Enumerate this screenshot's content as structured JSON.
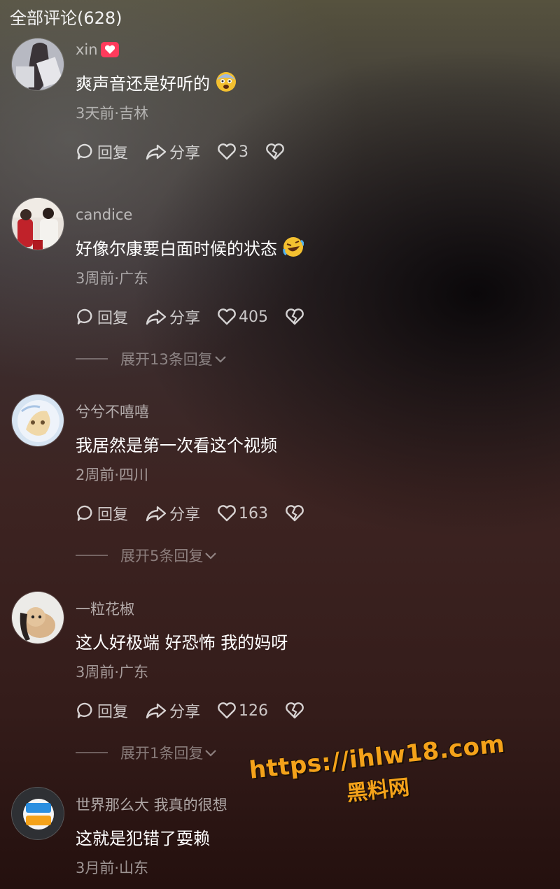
{
  "header": {
    "title": "全部评论(628)"
  },
  "actions": {
    "reply": "回复",
    "share": "分享"
  },
  "comments": [
    {
      "user": "xin",
      "text": "爽声音还是好听的",
      "meta": "3天前·吉林",
      "likes": "3",
      "emoji": "fearful-face",
      "badge": "heart-badge"
    },
    {
      "user": "candice",
      "text": "好像尔康要白面时候的状态",
      "meta": "3周前·广东",
      "likes": "405",
      "emoji": "rofl-face",
      "expand": "展开13条回复"
    },
    {
      "user": "兮兮不嘻嘻",
      "text": "我居然是第一次看这个视频",
      "meta": "2周前·四川",
      "likes": "163",
      "expand": "展开5条回复"
    },
    {
      "user": "一粒花椒",
      "text": "这人好极端 好恐怖 我的妈呀",
      "meta": "3周前·广东",
      "likes": "126",
      "expand": "展开1条回复"
    },
    {
      "user": "世界那么大 我真的很想",
      "text": "这就是犯错了耍赖",
      "meta": "3月前·山东"
    }
  ],
  "watermark": {
    "url": "https://ihlw18.com",
    "brand": "黑料网"
  },
  "colors": {
    "accent": "#ff3b5c",
    "watermark": "#f4a21a"
  }
}
